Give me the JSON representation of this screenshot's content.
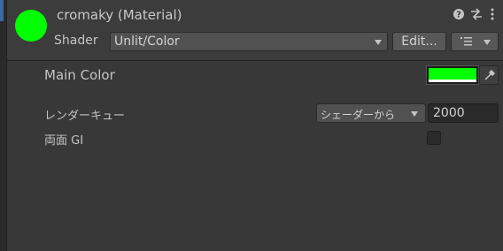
{
  "colors": {
    "material_color": "#00ff00",
    "main_color_value": "#00ff00"
  },
  "header": {
    "title": "cromaky (Material)",
    "help_icon": "?",
    "settings_icon": "⇄",
    "more_icon": "⋮",
    "shader_label": "Shader",
    "shader_value": "Unlit/Color",
    "edit_button": "Edit...",
    "list_icon": "☰"
  },
  "properties": {
    "main_color_label": "Main Color",
    "render_queue_label": "レンダーキュー",
    "render_queue_mode": "シェーダーから",
    "render_queue_value": "2000",
    "double_sided_gi_label": "両面 GI",
    "double_sided_gi_checked": false
  }
}
